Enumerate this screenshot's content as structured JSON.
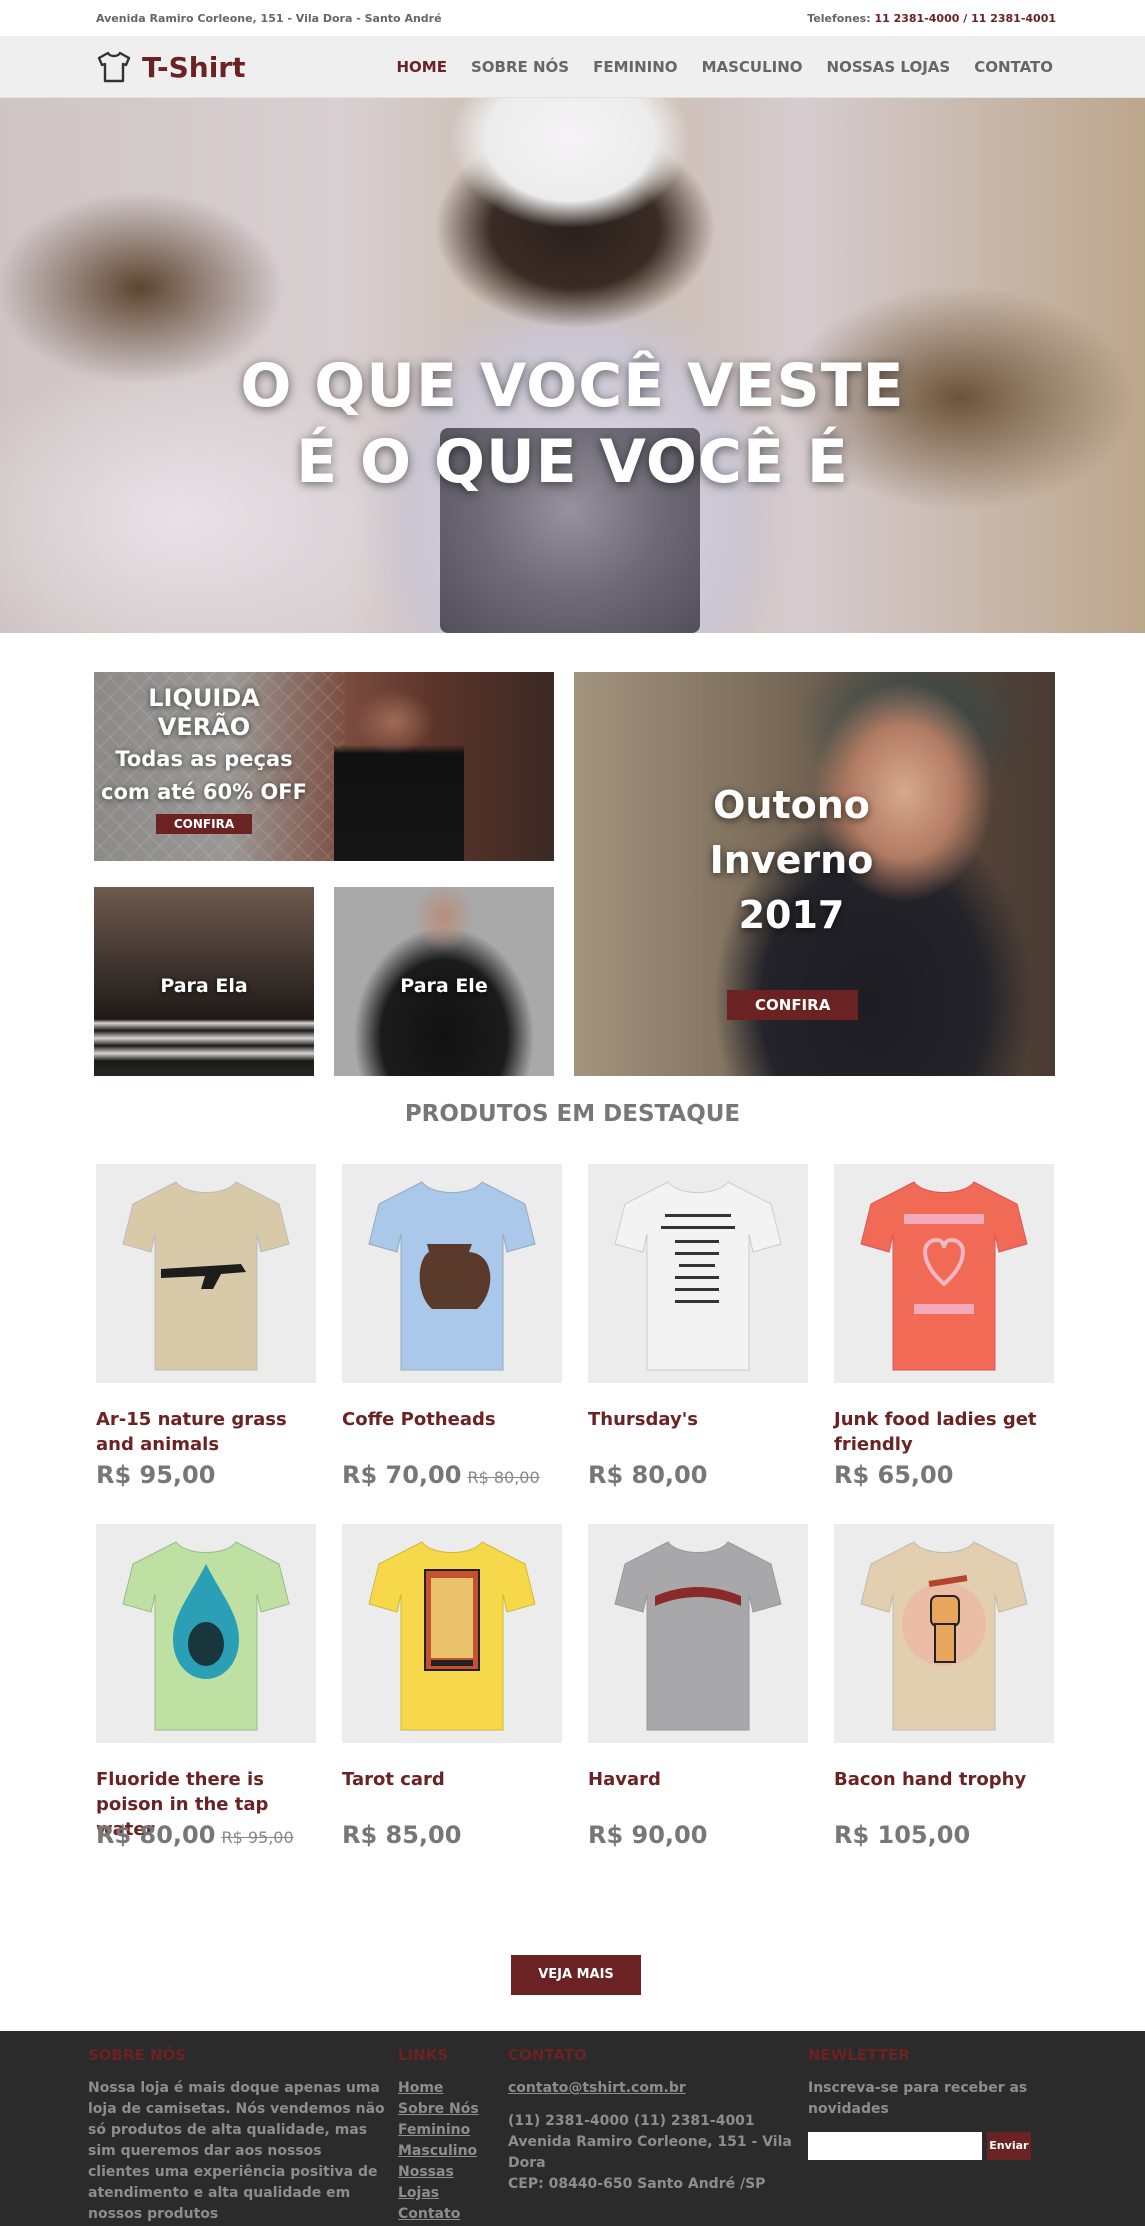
{
  "topbar": {
    "address": "Avenida Ramiro Corleone, 151 - Vila Dora - Santo André",
    "phones_label": "Telefones:",
    "phones": "11 2381-4000 / 11 2381-4001"
  },
  "header": {
    "logo": "T-Shirt",
    "nav": [
      "HOME",
      "SOBRE NÓS",
      "FEMININO",
      "MASCULINO",
      "NOSSAS LOJAS",
      "CONTATO"
    ],
    "active": "HOME"
  },
  "hero": {
    "line1": "O QUE VOCÊ VESTE",
    "line2": "É O QUE VOCÊ É"
  },
  "promos": {
    "liquida_title1": "LIQUIDA",
    "liquida_title2": "VERÃO",
    "liquida_sub1": "Todas as peças",
    "liquida_sub2": "com até 60% OFF",
    "liquida_button": "CONFIRA",
    "ela": "Para Ela",
    "ele": "Para Ele",
    "outono1": "Outono",
    "outono2": "Inverno",
    "outono3": "2017",
    "outono_button": "CONFIRA"
  },
  "featured": {
    "title": "PRODUTOS EM DESTAQUE",
    "products": [
      {
        "name": "Ar-15 nature grass and animals",
        "price": "R$ 95,00",
        "old": "",
        "color": "#d8c9a9"
      },
      {
        "name": "Coffe Potheads",
        "price": "R$ 70,00",
        "old": "R$ 80,00",
        "color": "#a9c8ea"
      },
      {
        "name": "Thursday's",
        "price": "R$ 80,00",
        "old": "",
        "color": "#f3f3f3"
      },
      {
        "name": "Junk food ladies get friendly",
        "price": "R$ 65,00",
        "old": "",
        "color": "#f06a56"
      },
      {
        "name": "Fluoride there is poison in the tap water",
        "price": "R$ 80,00",
        "old": "R$ 95,00",
        "color": "#bfe0a3"
      },
      {
        "name": "Tarot card",
        "price": "R$ 85,00",
        "old": "",
        "color": "#f7d84a"
      },
      {
        "name": "Havard",
        "price": "R$ 90,00",
        "old": "",
        "color": "#a8a8aa"
      },
      {
        "name": "Bacon hand trophy",
        "price": "R$ 105,00",
        "old": "",
        "color": "#e1cfb0"
      }
    ],
    "more_button": "VEJA MAIS"
  },
  "footer": {
    "about_title": "SOBRE NÓS",
    "about_text": "Nossa loja é mais doque apenas uma loja de camisetas. Nós vendemos não só produtos de alta qualidade, mas sim queremos dar aos nossos clientes uma experiência positiva de atendimento e alta qualidade em nossos produtos",
    "links_title": "LINKS",
    "links": [
      "Home",
      "Sobre Nós",
      "Feminino",
      "Masculino",
      "Nossas Lojas",
      "Contato"
    ],
    "contact_title": "CONTATO",
    "email": "contato@tshirt.com.br",
    "phones": "(11) 2381-4000 (11) 2381-4001",
    "address": "Avenida Ramiro Corleone, 151 - Vila Dora",
    "cep": "CEP: 08440-650 Santo André /SP",
    "news_title": "NEWLETTER",
    "news_text": "Inscreva-se para receber as novidades",
    "news_button": "Enviar"
  },
  "colors": {
    "brand": "#6b2222",
    "footer_bg": "#2b2b2b"
  }
}
